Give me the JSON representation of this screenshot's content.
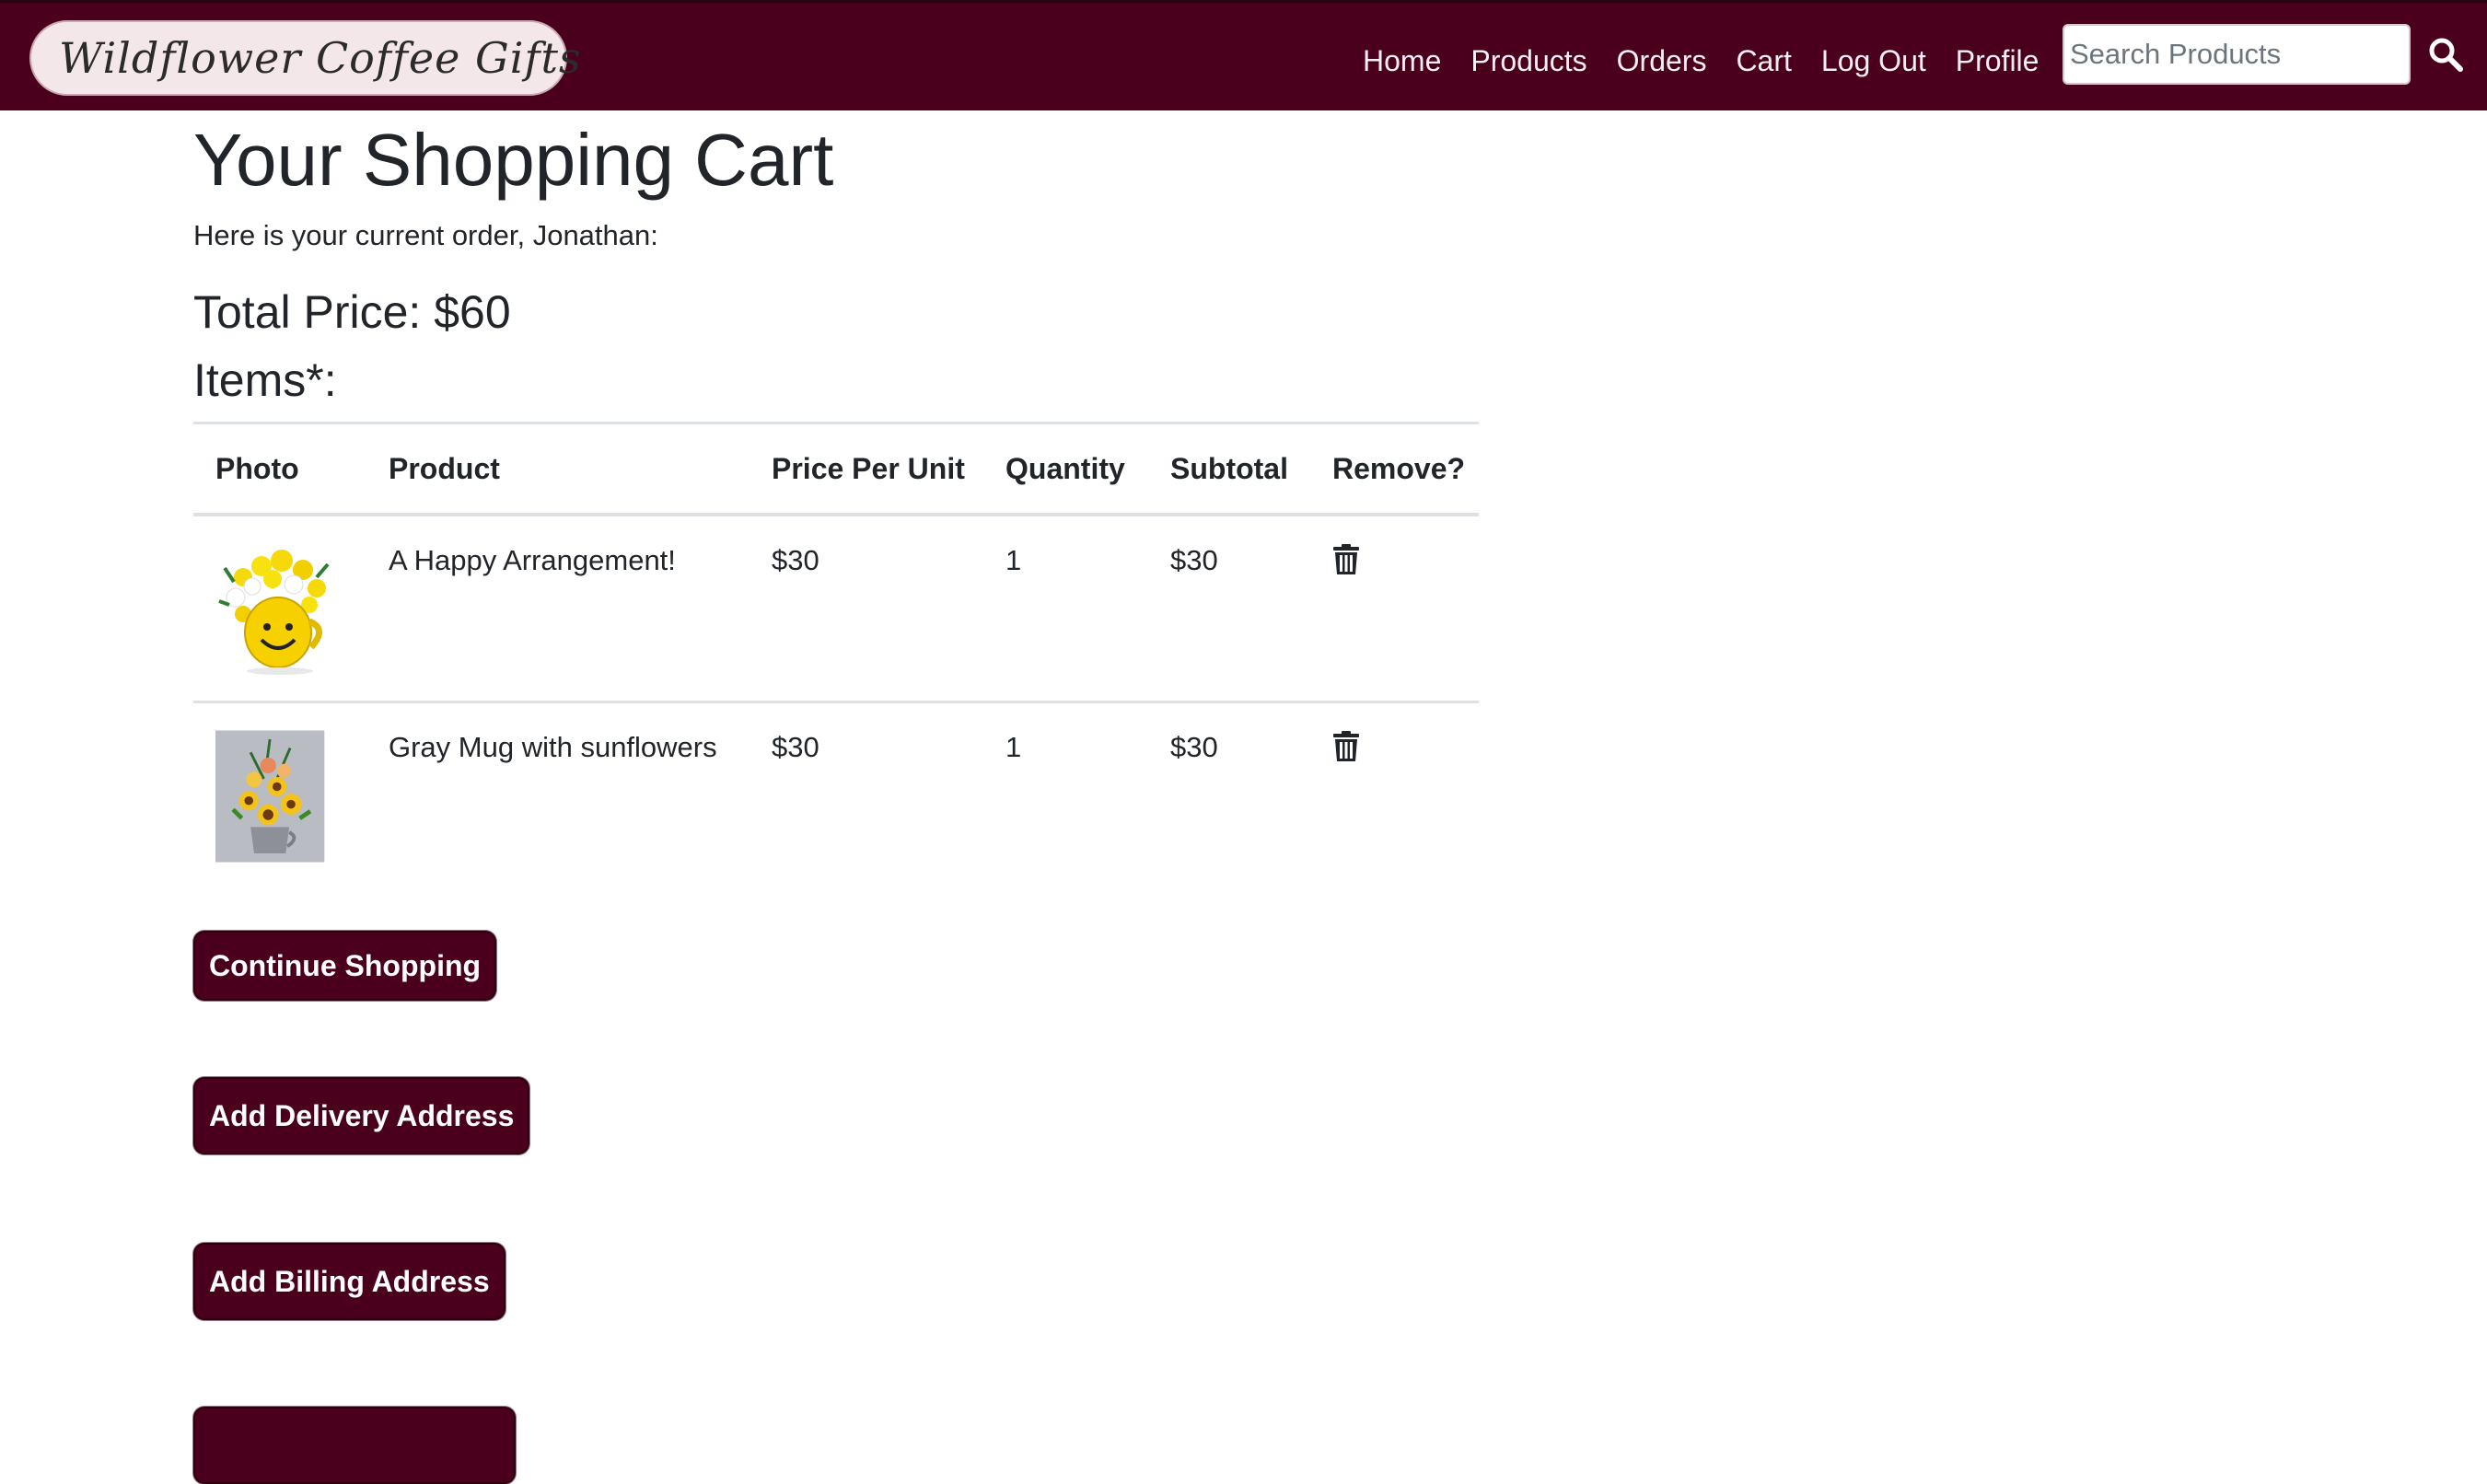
{
  "navbar": {
    "brand": "Wildflower Coffee Gifts",
    "links": [
      "Home",
      "Products",
      "Orders",
      "Cart",
      "Log Out",
      "Profile"
    ],
    "search_placeholder": "Search Products"
  },
  "page": {
    "title": "Your Shopping Cart",
    "intro": "Here is your current order, Jonathan:",
    "total_price": "Total Price: $60",
    "items_heading": "Items*:"
  },
  "table": {
    "headers": [
      "Photo",
      "Product",
      "Price Per Unit",
      "Quantity",
      "Subtotal",
      "Remove?"
    ],
    "rows": [
      {
        "product": "A Happy Arrangement!",
        "price": "$30",
        "quantity": "1",
        "subtotal": "$30",
        "photo_icon": "smiley-mug-flowers-image"
      },
      {
        "product": "Gray Mug with sunflowers",
        "price": "$30",
        "quantity": "1",
        "subtotal": "$30",
        "photo_icon": "gray-mug-sunflowers-image"
      }
    ]
  },
  "buttons": {
    "continue": "Continue Shopping",
    "delivery": "Add Delivery Address",
    "billing": "Add Billing Address"
  },
  "colors": {
    "brand": "#4a001c",
    "brand_pill": "#f4e7ea"
  }
}
